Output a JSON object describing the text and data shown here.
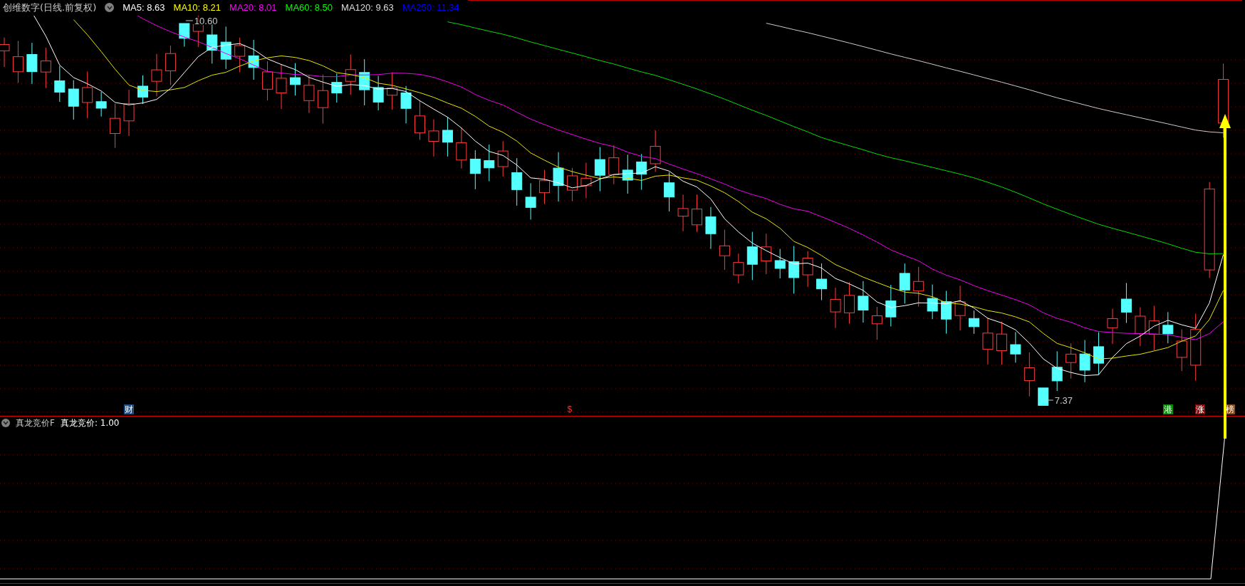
{
  "header": {
    "title": "创维数字(日线.前复权)",
    "indicators": [
      {
        "label": "MA5: 8.63",
        "color": "#ffffff"
      },
      {
        "label": "MA10: 8.21",
        "color": "#ffff00"
      },
      {
        "label": "MA20: 8.01",
        "color": "#ff00ff"
      },
      {
        "label": "MA60: 8.50",
        "color": "#00ff00"
      },
      {
        "label": "MA120: 9.63",
        "color": "#dddddd"
      },
      {
        "label": "MA250: 11.34",
        "color": "#0000ff"
      }
    ]
  },
  "price_chart": {
    "high_label": "10.60",
    "low_label": "7.37",
    "event_markers": [
      {
        "text": "财",
        "kind": "badge",
        "color": "#1a4f8a"
      },
      {
        "text": "$",
        "kind": "glyph",
        "color": "#ff3030"
      },
      {
        "text": "港",
        "kind": "badge",
        "color": "#0a8a0a"
      },
      {
        "text": "涨",
        "kind": "badge",
        "color": "#8a0a0a"
      },
      {
        "text": "榜",
        "kind": "badge",
        "color": "#8a4a10"
      }
    ]
  },
  "indicator_panel": {
    "name": "真龙竞价F",
    "reading": "真龙竞价: 1.00"
  }
}
